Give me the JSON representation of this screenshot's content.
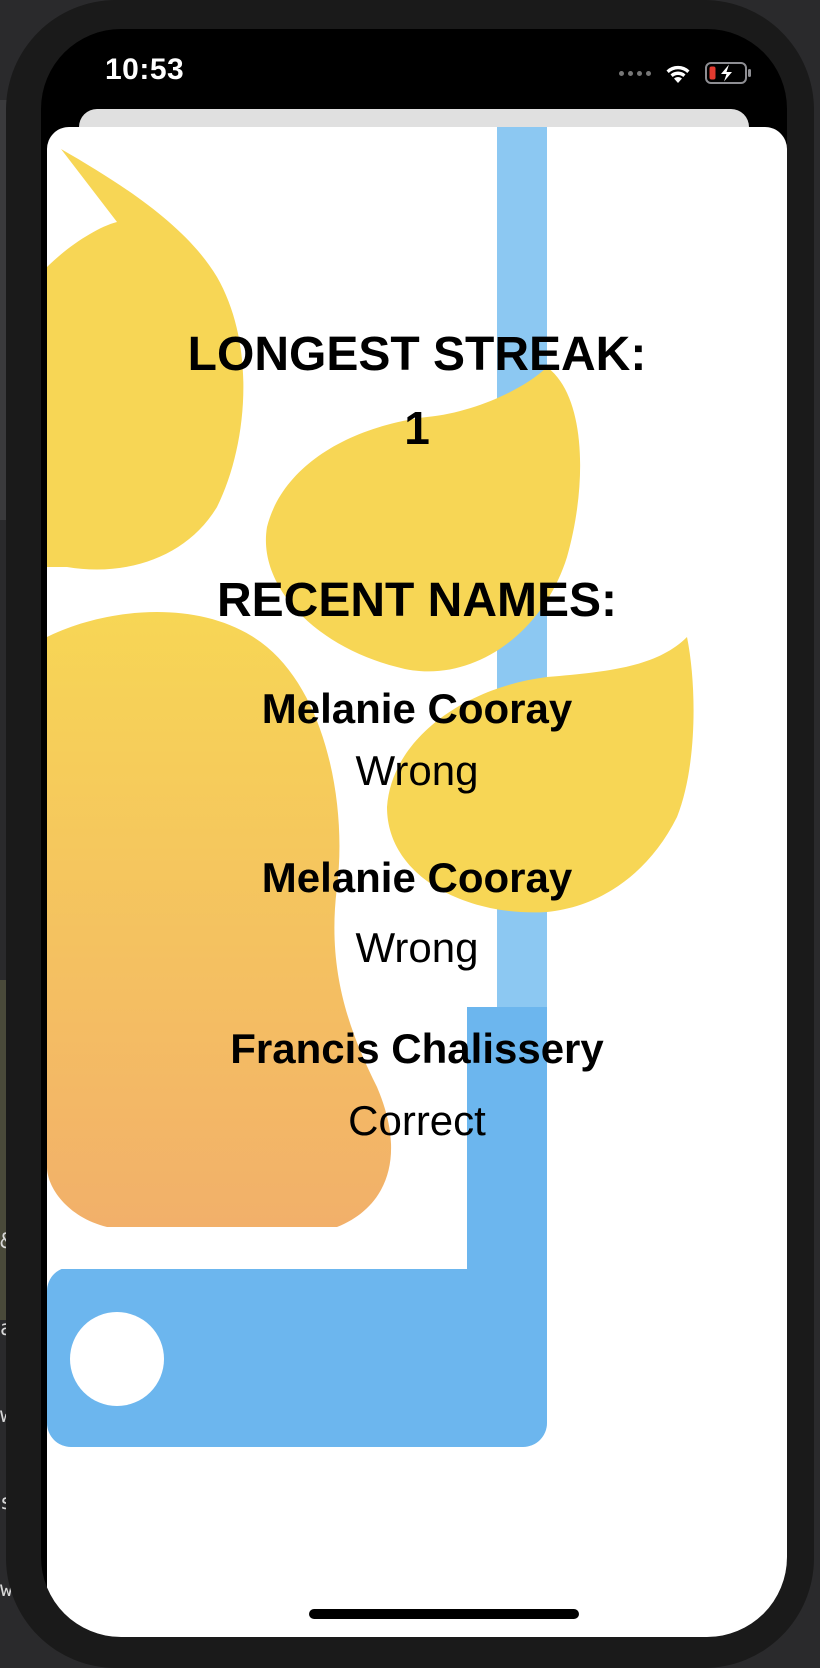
{
  "status_bar": {
    "time": "10:53",
    "icons": [
      "cellular-dots-icon",
      "wifi-icon",
      "battery-charging-icon"
    ]
  },
  "colors": {
    "paw_yellow": "#f7d655",
    "paw_orange": "#f2b06a",
    "phone_blue": "#6cb6ee",
    "sheet_bg": "#ffffff",
    "text": "#000000",
    "battery_low": "#e33a2f"
  },
  "stats": {
    "streak_label": "LONGEST STREAK:",
    "streak_value": "1",
    "recent_label": "RECENT NAMES:"
  },
  "recent": [
    {
      "name": "Melanie Cooray",
      "result": "Wrong"
    },
    {
      "name": "Melanie Cooray",
      "result": "Wrong"
    },
    {
      "name": "Francis Chalissery",
      "result": "Correct"
    }
  ],
  "background_code": [
    "&",
    "a",
    "w",
    "st",
    "wi"
  ]
}
